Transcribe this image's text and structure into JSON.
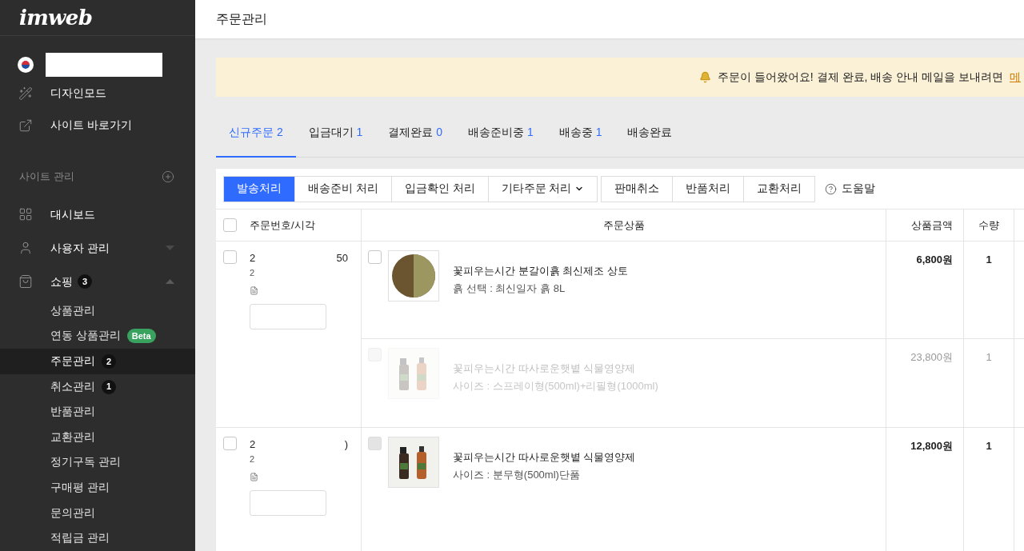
{
  "sidebar": {
    "logo": "imweb",
    "top_items": [
      {
        "kind": "wand",
        "label": "디자인모드"
      },
      {
        "kind": "external",
        "label": "사이트 바로가기"
      }
    ],
    "section": {
      "title": "사이트 관리"
    },
    "menu": [
      {
        "kind": "grid",
        "label": "대시보드"
      },
      {
        "kind": "user",
        "label": "사용자 관리",
        "expanded": false
      },
      {
        "kind": "bag",
        "label": "쇼핑",
        "count": "3",
        "expanded": true,
        "children": [
          {
            "label": "상품관리",
            "selected": false
          },
          {
            "label": "연동 상품관리",
            "tag": "Beta",
            "selected": false
          },
          {
            "label": "주문관리",
            "count": "2",
            "selected": true
          },
          {
            "label": "취소관리",
            "count": "1",
            "selected": false
          },
          {
            "label": "반품관리",
            "selected": false
          },
          {
            "label": "교환관리",
            "selected": false
          },
          {
            "label": "정기구독 관리",
            "selected": false
          },
          {
            "label": "구매평 관리",
            "selected": false
          },
          {
            "label": "문의관리",
            "selected": false
          },
          {
            "label": "적립금 관리",
            "selected": false
          }
        ]
      }
    ]
  },
  "header": {
    "title": "주문관리"
  },
  "notice": {
    "text": "주문이 들어왔어요! 결제 완료, 배송 안내 메일을 보내려면",
    "link": "메"
  },
  "tabs": [
    {
      "label": "신규주문",
      "count": "2",
      "selected": true
    },
    {
      "label": "입금대기",
      "count": "1",
      "selected": false
    },
    {
      "label": "결제완료",
      "count": "0",
      "selected": false
    },
    {
      "label": "배송준비중",
      "count": "1",
      "selected": false
    },
    {
      "label": "배송중",
      "count": "1",
      "selected": false
    },
    {
      "label": "배송완료",
      "selected": false
    }
  ],
  "toolbar": {
    "groups": [
      [
        {
          "label": "발송처리",
          "primary": true
        },
        {
          "label": "배송준비 처리",
          "primary": false
        },
        {
          "label": "입금확인 처리",
          "primary": false
        },
        {
          "label": "기타주문 처리",
          "primary": false,
          "dropdown": true
        }
      ],
      [
        {
          "label": "판매취소",
          "primary": false
        },
        {
          "label": "반품처리",
          "primary": false
        },
        {
          "label": "교환처리",
          "primary": false
        }
      ]
    ],
    "help": "도움말"
  },
  "table": {
    "select_all_checked": false,
    "columns": [
      "주문번호/시각",
      "주문상품",
      "상품금액",
      "수량"
    ],
    "orders": [
      {
        "checked": false,
        "number_start": "2",
        "number_end": "50",
        "time_start": "2",
        "items": [
          {
            "name": "꽃피우는시간 분갈이흙 최신제조 상토",
            "option": "흙 선택 : 최신일자 흙 8L",
            "price": "6,800원",
            "qty": "1",
            "checked": false,
            "faded": false,
            "checkbox_disabled": false,
            "kind": "soil"
          },
          {
            "name": "꽃피우는시간 따사로운햇볕 식물영양제",
            "option": "사이즈 : 스프레이형(500ml)+리필형(1000ml)",
            "price": "23,800원",
            "qty": "1",
            "checked": false,
            "faded": true,
            "checkbox_disabled": true,
            "kind": "bottles"
          }
        ]
      },
      {
        "checked": false,
        "number_start": "2",
        "number_end": ")",
        "time_start": "2",
        "items": [
          {
            "name": "꽃피우는시간 따사로운햇볕 식물영양제",
            "option": "사이즈 : 분무형(500ml)단품",
            "price": "12,800원",
            "qty": "1",
            "checked": false,
            "faded": false,
            "checkbox_disabled": true,
            "kind": "bottles"
          }
        ]
      }
    ]
  }
}
